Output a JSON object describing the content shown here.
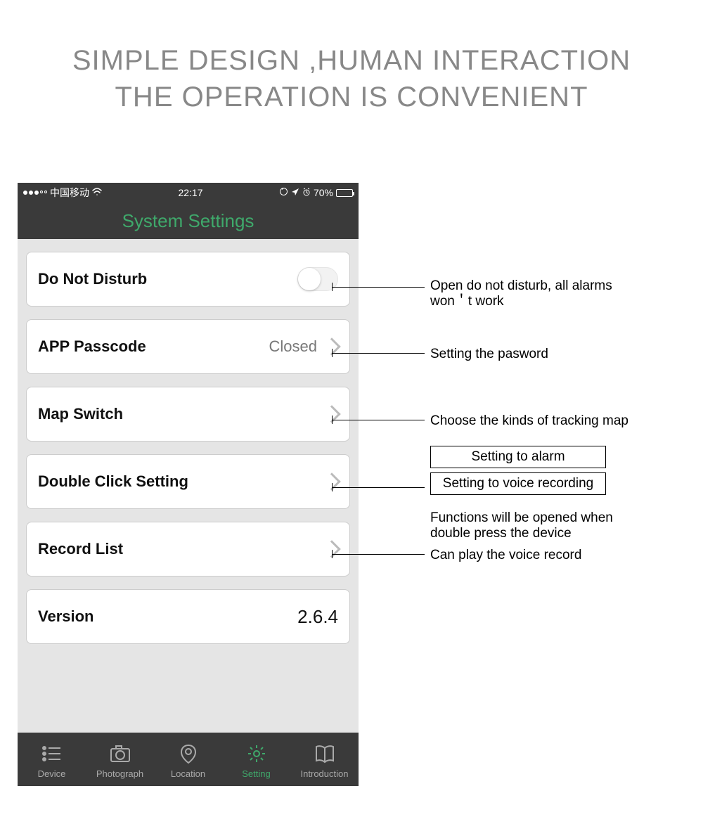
{
  "headline_line1": "SIMPLE DESIGN ,HUMAN INTERACTION",
  "headline_line2": "THE OPERATION IS CONVENIENT",
  "status": {
    "carrier": "中国移动",
    "time": "22:17",
    "battery_pct": "70%"
  },
  "nav_title": "System Settings",
  "rows": {
    "dnd": {
      "label": "Do Not Disturb"
    },
    "passcode": {
      "label": "APP Passcode",
      "value": "Closed"
    },
    "mapswitch": {
      "label": "Map Switch"
    },
    "doubleclick": {
      "label": "Double Click Setting"
    },
    "recordlist": {
      "label": "Record List"
    },
    "version": {
      "label": "Version",
      "value": "2.6.4"
    }
  },
  "tabs": {
    "device": "Device",
    "photograph": "Photograph",
    "location": "Location",
    "setting": "Setting",
    "introduction": "Introduction"
  },
  "annotations": {
    "dnd": "Open do not disturb, all alarms won＇t work",
    "passcode": "Setting the pasword",
    "mapswitch": "Choose the kinds of tracking map",
    "dblclick_box1": "Setting to alarm",
    "dblclick_box2": "Setting to voice recording",
    "dblclick_note": "Functions will be opened when double press the device",
    "recordlist": "Can play the voice record"
  }
}
